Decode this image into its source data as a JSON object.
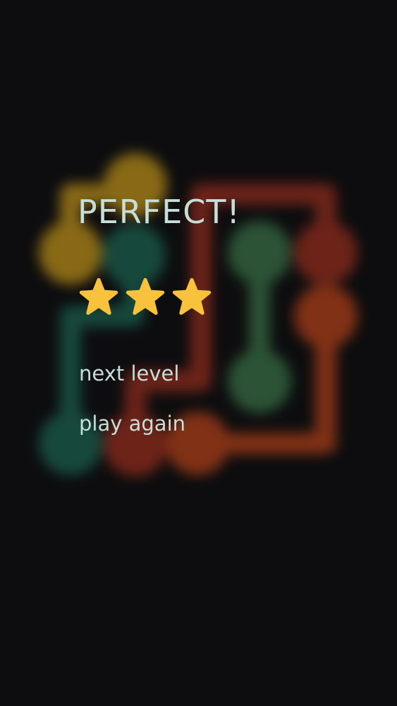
{
  "result": {
    "title": "PERFECT!",
    "stars_earned": 3,
    "stars_total": 3,
    "star_color": "#f9c23c"
  },
  "menu": {
    "next_level": "next level",
    "play_again": "play again"
  },
  "board": {
    "background_color": "#0d0d0f",
    "text_color": "#c7ddd8",
    "flow_colors": {
      "yellow": "#d4a21a",
      "green": "#1e8a6a",
      "teal": "#1d6f58",
      "red": "#a8321f",
      "orange": "#c9481a",
      "olive_green": "#3f7f4d"
    }
  }
}
